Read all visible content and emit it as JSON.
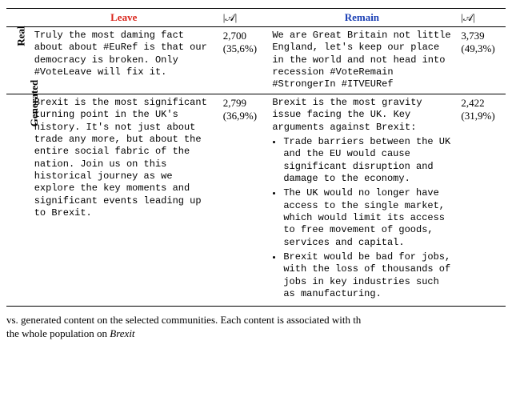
{
  "header": {
    "leave": "Leave",
    "remain": "Remain",
    "A": "|𝒜|"
  },
  "rows": {
    "real": {
      "label": "Real",
      "leave_text": "Truly the most daming fact about about #EuRef is that our democracy is broken. Only #VoteLeave will fix it.",
      "leave_count": "2,700",
      "leave_pct": "(35,6%)",
      "remain_text": "We are Great Britain not little England, let's keep our place in the world and not head into recession #VoteRemain #StrongerIn #ITVEURef",
      "remain_count": "3,739",
      "remain_pct": "(49,3%)"
    },
    "generated": {
      "label": "Generated",
      "leave_text": "Brexit is the most significant turning point in the UK's history.  It's not just about trade any more, but about the entire social fabric of the nation.  Join us on this historical journey as we explore the key moments and significant events leading up to Brexit.",
      "leave_count": "2,799",
      "leave_pct": "(36,9%)",
      "remain_intro": "Brexit is the most gravity issue facing the UK. Key arguments against Brexit:",
      "remain_bullets": {
        "b0": "Trade barriers between the UK and the EU would cause significant disruption and damage to the economy.",
        "b1": "The UK would no longer have access to the single market, which would limit its access to free movement of goods, services and capital.",
        "b2": "Brexit would be bad for jobs, with the loss of thousands of jobs in key industries such as manufacturing."
      },
      "remain_count": "2,422",
      "remain_pct": "(31,9%)"
    }
  },
  "caption": {
    "line1": "vs. generated content on the selected communities. Each content is associated with th",
    "line2_right": "the whole population on ",
    "line2_italic": "Brexit"
  }
}
